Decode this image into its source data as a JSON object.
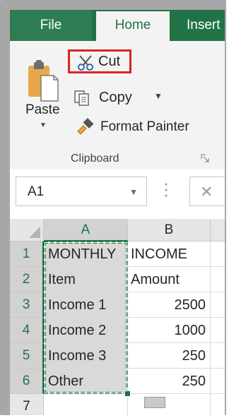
{
  "tabs": {
    "file": "File",
    "home": "Home",
    "insert": "Insert"
  },
  "clipboard": {
    "paste_label": "Paste",
    "cut_label": "Cut",
    "copy_label": "Copy",
    "format_painter_label": "Format Painter",
    "group_label": "Clipboard"
  },
  "formula_bar": {
    "name_box": "A1"
  },
  "grid": {
    "columns": [
      "A",
      "B"
    ],
    "rows": [
      {
        "num": "1",
        "a": "MONTHLY",
        "b": "INCOME"
      },
      {
        "num": "2",
        "a": "Item",
        "b": "Amount"
      },
      {
        "num": "3",
        "a": "Income 1",
        "b": "2500"
      },
      {
        "num": "4",
        "a": "Income 2",
        "b": "1000"
      },
      {
        "num": "5",
        "a": "Income 3",
        "b": "250"
      },
      {
        "num": "6",
        "a": "Other",
        "b": "250"
      },
      {
        "num": "7",
        "a": "",
        "b": ""
      }
    ]
  },
  "colors": {
    "accent": "#217346",
    "highlight_border": "#e02020"
  }
}
